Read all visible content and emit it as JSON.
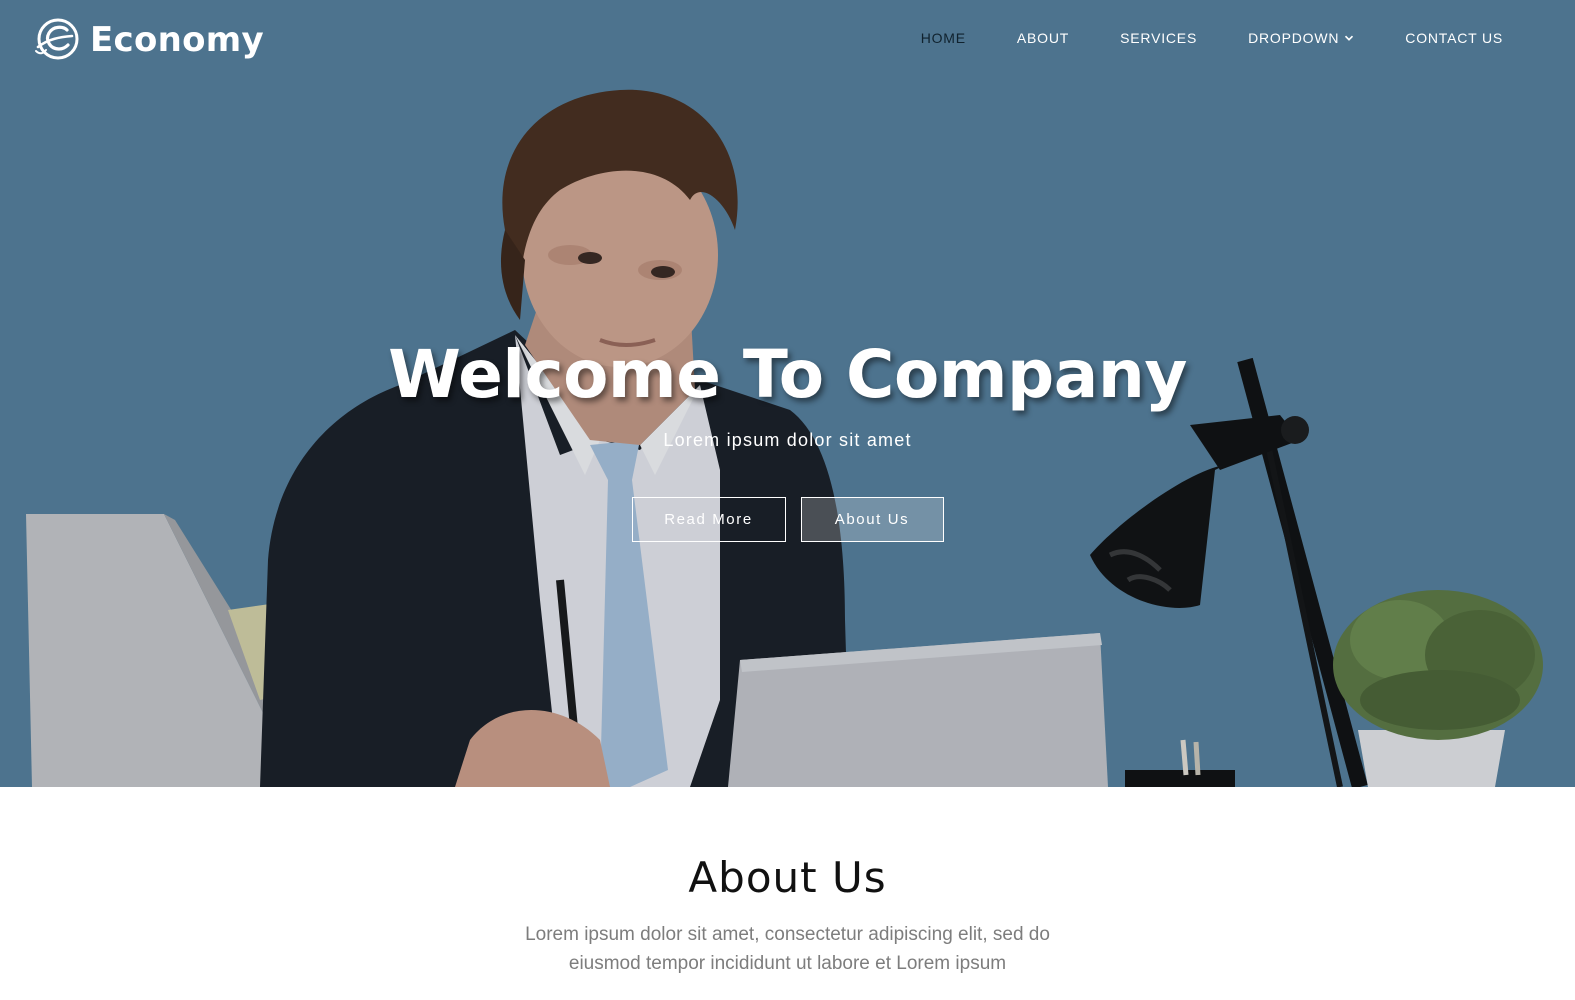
{
  "brand": {
    "name": "Economy",
    "icon": "globe-e-logo-icon"
  },
  "nav": {
    "items": [
      {
        "label": "HOME",
        "active": true
      },
      {
        "label": "ABOUT",
        "active": false
      },
      {
        "label": "SERVICES",
        "active": false
      },
      {
        "label": "DROPDOWN",
        "active": false,
        "icon": "chevron-down-icon"
      },
      {
        "label": "CONTACT US",
        "active": false
      }
    ]
  },
  "hero": {
    "title": "Welcome To Company",
    "subtitle": "Lorem ipsum dolor sit amet",
    "buttons": {
      "read_more": "Read More",
      "about_us": "About Us"
    }
  },
  "about": {
    "title": "About Us",
    "text_line1": "Lorem ipsum dolor sit amet, consectetur adipiscing elit, sed do",
    "text_line2": "eiusmod tempor incididunt ut labore et Lorem ipsum"
  },
  "colors": {
    "hero_background": "#5c85a0",
    "active_nav": "#10222e",
    "about_text": "#7d7d7d",
    "heading": "#111111"
  }
}
